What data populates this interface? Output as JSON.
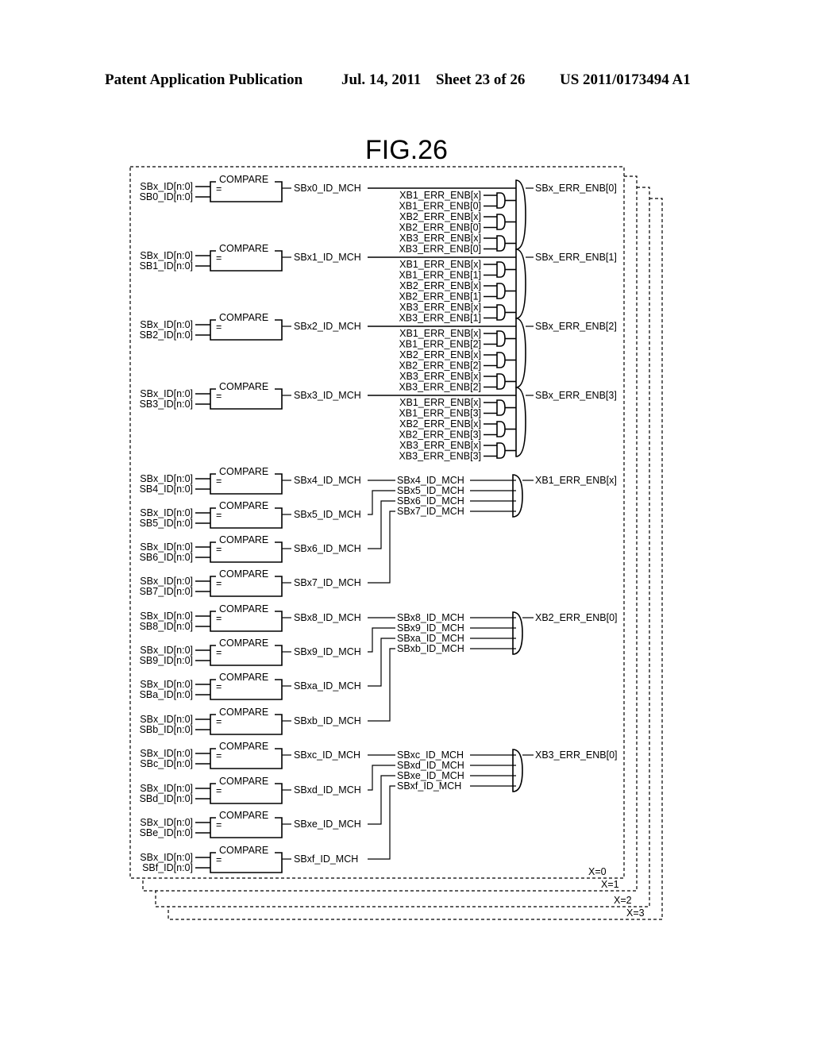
{
  "header": {
    "publication": "Patent Application Publication",
    "date": "Jul. 14, 2011",
    "sheet": "Sheet 23 of 26",
    "number": "US 2011/0173494 A1"
  },
  "figure": {
    "title": "FIG.26",
    "compare_label": "COMPARE",
    "equals_symbol": "=",
    "common_input": "SBx_ID[n:0]",
    "comparators": [
      {
        "input": "SB0_ID[n:0]",
        "output": "SBx0_ID_MCH"
      },
      {
        "input": "SB1_ID[n:0]",
        "output": "SBx1_ID_MCH"
      },
      {
        "input": "SB2_ID[n:0]",
        "output": "SBx2_ID_MCH"
      },
      {
        "input": "SB3_ID[n:0]",
        "output": "SBx3_ID_MCH"
      },
      {
        "input": "SB4_ID[n:0]",
        "output": "SBx4_ID_MCH"
      },
      {
        "input": "SB5_ID[n:0]",
        "output": "SBx5_ID_MCH"
      },
      {
        "input": "SB6_ID[n:0]",
        "output": "SBx6_ID_MCH"
      },
      {
        "input": "SB7_ID[n:0]",
        "output": "SBx7_ID_MCH"
      },
      {
        "input": "SB8_ID[n:0]",
        "output": "SBx8_ID_MCH"
      },
      {
        "input": "SB9_ID[n:0]",
        "output": "SBx9_ID_MCH"
      },
      {
        "input": "SBa_ID[n:0]",
        "output": "SBxa_ID_MCH"
      },
      {
        "input": "SBb_ID[n:0]",
        "output": "SBxb_ID_MCH"
      },
      {
        "input": "SBc_ID[n:0]",
        "output": "SBxc_ID_MCH"
      },
      {
        "input": "SBd_ID[n:0]",
        "output": "SBxd_ID_MCH"
      },
      {
        "input": "SBe_ID[n:0]",
        "output": "SBxe_ID_MCH"
      },
      {
        "input": "SBf_ID[n:0]",
        "output": "SBxf_ID_MCH"
      }
    ],
    "err_enable_groups": [
      {
        "output": "SBx_ERR_ENB[0]",
        "inputs": [
          "XB1_ERR_ENB[x]",
          "XB1_ERR_ENB[0]",
          "XB2_ERR_ENB[x]",
          "XB2_ERR_ENB[0]",
          "XB3_ERR_ENB[x]",
          "XB3_ERR_ENB[0]"
        ]
      },
      {
        "output": "SBx_ERR_ENB[1]",
        "inputs": [
          "XB1_ERR_ENB[x]",
          "XB1_ERR_ENB[1]",
          "XB2_ERR_ENB[x]",
          "XB2_ERR_ENB[1]",
          "XB3_ERR_ENB[x]",
          "XB3_ERR_ENB[1]"
        ]
      },
      {
        "output": "SBx_ERR_ENB[2]",
        "inputs": [
          "XB1_ERR_ENB[x]",
          "XB1_ERR_ENB[2]",
          "XB2_ERR_ENB[x]",
          "XB2_ERR_ENB[2]",
          "XB3_ERR_ENB[x]",
          "XB3_ERR_ENB[2]"
        ]
      },
      {
        "output": "SBx_ERR_ENB[3]",
        "inputs": [
          "XB1_ERR_ENB[x]",
          "XB1_ERR_ENB[3]",
          "XB2_ERR_ENB[x]",
          "XB2_ERR_ENB[3]",
          "XB3_ERR_ENB[x]",
          "XB3_ERR_ENB[3]"
        ]
      }
    ],
    "or_groups": [
      {
        "output": "XB1_ERR_ENB[x]",
        "inputs": [
          "SBx4_ID_MCH",
          "SBx5_ID_MCH",
          "SBx6_ID_MCH",
          "SBx7_ID_MCH"
        ]
      },
      {
        "output": "XB2_ERR_ENB[0]",
        "inputs": [
          "SBx8_ID_MCH",
          "SBx9_ID_MCH",
          "SBxa_ID_MCH",
          "SBxb_ID_MCH"
        ]
      },
      {
        "output": "XB3_ERR_ENB[0]",
        "inputs": [
          "SBxc_ID_MCH",
          "SBxd_ID_MCH",
          "SBxe_ID_MCH",
          "SBxf_ID_MCH"
        ]
      }
    ],
    "layers": [
      "X=0",
      "X=1",
      "X=2",
      "X=3"
    ]
  }
}
